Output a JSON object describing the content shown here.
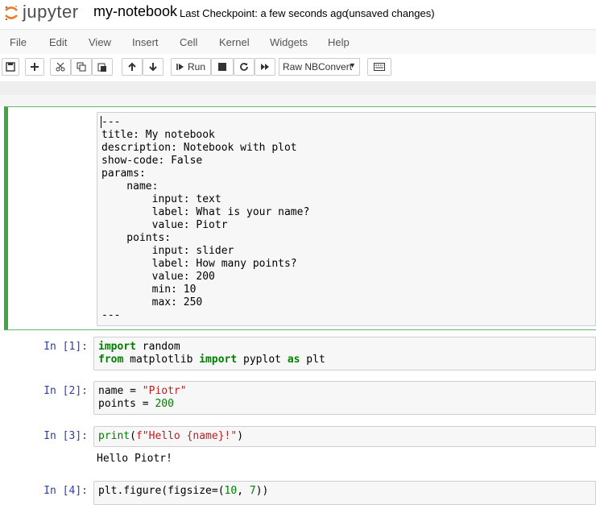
{
  "header": {
    "brand": "jupyter",
    "notebook_name": "my-notebook",
    "checkpoint": "Last Checkpoint: a few seconds ago",
    "unsaved": "(unsaved changes)"
  },
  "menu": [
    "File",
    "Edit",
    "View",
    "Insert",
    "Cell",
    "Kernel",
    "Widgets",
    "Help"
  ],
  "toolbar": {
    "run_label": "Run",
    "cell_type": "Raw NBConvert",
    "icons": [
      "save-icon",
      "plus-icon",
      "scissors-icon",
      "copy-icon",
      "paste-icon",
      "arrow-up-icon",
      "arrow-down-icon",
      "step-forward-icon",
      "stop-icon",
      "restart-icon",
      "fast-forward-icon",
      "keyboard-icon"
    ]
  },
  "cells": {
    "raw": {
      "lines": [
        "---",
        "title: My notebook",
        "description: Notebook with plot",
        "show-code: False",
        "params:",
        "    name:",
        "        input: text",
        "        label: What is your name?",
        "        value: Piotr",
        "    points:",
        "        input: slider",
        "        label: How many points?",
        "        value: 200",
        "        min: 10",
        "        max: 250",
        "---"
      ]
    },
    "c1": {
      "prompt": "In [1]:",
      "line1": {
        "kw1": "import",
        "rest1": " random"
      },
      "line2": {
        "kw1": "from",
        "mid": " matplotlib ",
        "kw2": "import",
        "mid2": " pyplot ",
        "kw3": "as",
        "end": " plt"
      }
    },
    "c2": {
      "prompt": "In [2]:",
      "line1": {
        "a": "name = ",
        "s": "\"Piotr\""
      },
      "line2": {
        "a": "points = ",
        "n": "200"
      }
    },
    "c3": {
      "prompt": "In [3]:",
      "line1": {
        "fn": "print",
        "a": "(",
        "s": "f\"Hello {name}!\"",
        "b": ")"
      },
      "output": "Hello Piotr!"
    },
    "c4": {
      "prompt": "In [4]:",
      "line1": {
        "a": "plt.figure(figsize=(",
        "n1": "10",
        "b": ", ",
        "n2": "7",
        "c": "))"
      }
    }
  },
  "colors": {
    "selected_border": "#42a545",
    "prompt": "#303f9f",
    "keyword": "#008000",
    "string": "#ba2121"
  }
}
